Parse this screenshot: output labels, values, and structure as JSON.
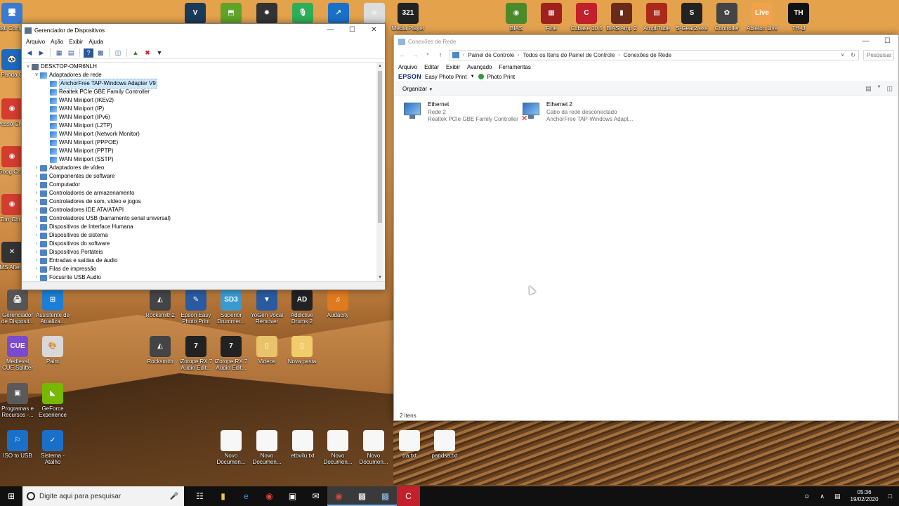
{
  "desktop": {
    "top_icons": [
      {
        "label": "",
        "glyph": "V",
        "color": "#1b3a5a"
      },
      {
        "label": "",
        "glyph": "⬒",
        "color": "#5fa329"
      },
      {
        "label": "",
        "glyph": "✹",
        "color": "#333333"
      },
      {
        "label": "",
        "glyph": "🎙",
        "color": "#2fae5a"
      },
      {
        "label": "",
        "glyph": "↗",
        "color": "#1a70c8"
      },
      {
        "label": "",
        "glyph": "☠",
        "color": "#dddddd"
      },
      {
        "label": "Media Player",
        "glyph": "321",
        "color": "#222222"
      },
      {
        "label": "BIAS",
        "glyph": "◉",
        "color": "#4a8a2a"
      },
      {
        "label": "Fine",
        "glyph": "▦",
        "color": "#a0201e"
      },
      {
        "label": "Cubase 10.5",
        "glyph": "C",
        "color": "#c2202a"
      },
      {
        "label": "BIAS Amp 2",
        "glyph": "▮",
        "color": "#6a2a1a"
      },
      {
        "label": "AmpliTube",
        "glyph": "▤",
        "color": "#aa2a1a"
      },
      {
        "label": "S-Gear2.exe -",
        "glyph": "S",
        "color": "#222222"
      },
      {
        "label": "Controller",
        "glyph": "✿",
        "color": "#444444"
      },
      {
        "label": "Ableton Live",
        "glyph": "Live",
        "color": "#f1a24a"
      },
      {
        "label": "TH-U",
        "glyph": "TH",
        "color": "#111111"
      }
    ],
    "left_icons": [
      {
        "label": "Esti Compu",
        "glyph": "🖥",
        "color": "#3a7ad0"
      },
      {
        "label": "",
        "glyph": "◉",
        "color": "#d33c2e"
      },
      {
        "label": "Panda C",
        "glyph": "🐼",
        "color": "#1c6ac0"
      },
      {
        "label": "Pesso Chro",
        "glyph": "◉",
        "color": "#d33c2e"
      },
      {
        "label": "Goog Chro",
        "glyph": "◉",
        "color": "#d33c2e"
      },
      {
        "label": "Torr Chro",
        "glyph": "◉",
        "color": "#d33c2e"
      },
      {
        "label": "MS Afterb",
        "glyph": "✕",
        "color": "#333333"
      }
    ],
    "grid_icons": [
      {
        "label": "Gerenciador de Disposit...",
        "glyph": "🖨",
        "color": "#555555"
      },
      {
        "label": "Assistente de Atualiza...",
        "glyph": "⊞",
        "color": "#1b7fd6"
      },
      {
        "label": "Rocksmith2",
        "glyph": "◭",
        "color": "#444444"
      },
      {
        "label": "Epson Easy Photo Print",
        "glyph": "✎",
        "color": "#2a5aa0"
      },
      {
        "label": "Superior Drummer...",
        "glyph": "SD3",
        "color": "#3a9ad0"
      },
      {
        "label": "YoGen Vocal Remover",
        "glyph": "▼",
        "color": "#2a5aa0"
      },
      {
        "label": "Addictive Drums 2",
        "glyph": "AD",
        "color": "#222222"
      },
      {
        "label": "Audacity",
        "glyph": "♫",
        "color": "#e07a1e"
      },
      {
        "label": "Medieval CUE Splitter",
        "glyph": "CUE",
        "color": "#7a4ad0"
      },
      {
        "label": "Paint",
        "glyph": "🎨",
        "color": "#d8d8d8"
      },
      {
        "label": "Rocksmith",
        "glyph": "◭",
        "color": "#444444"
      },
      {
        "label": "iZotope RX 7 Audio Edit...",
        "glyph": "7",
        "color": "#222222"
      },
      {
        "label": "iZotope RX 7 Audio Edit...",
        "glyph": "7",
        "color": "#222222"
      },
      {
        "label": "Videos",
        "glyph": "▯",
        "color": "#e9c36a"
      },
      {
        "label": "Nova pasta",
        "glyph": "▯",
        "color": "#f0cc6a"
      },
      {
        "label": "Programas e Recursos -...",
        "glyph": "▣",
        "color": "#5a5a5a"
      },
      {
        "label": "GeForce Experience",
        "glyph": "◣",
        "color": "#76b900"
      },
      {
        "label": "ISO to USB",
        "glyph": "⚐",
        "color": "#1a70c8"
      },
      {
        "label": "Sistema - Atalho",
        "glyph": "✓",
        "color": "#1a70c8"
      }
    ],
    "file_icons": [
      {
        "label": "Novo Documen..."
      },
      {
        "label": "Novo Documen..."
      },
      {
        "label": "etbvilu.txt"
      },
      {
        "label": "Novo Documen..."
      },
      {
        "label": "Novo Documen..."
      },
      {
        "label": "tra.txt"
      },
      {
        "label": "pandsa.txt"
      }
    ]
  },
  "device_manager": {
    "title": "Gerenciador de Dispositivos",
    "menu": [
      "Arquivo",
      "Ação",
      "Exibir",
      "Ajuda"
    ],
    "root": "DESKTOP-OMR6NLH",
    "expanded_category": "Adaptadores de rede",
    "adapters": [
      "AnchorFree TAP-Windows Adapter V9",
      "Realtek PCIe GBE Family Controller",
      "WAN Miniport (IKEv2)",
      "WAN Miniport (IP)",
      "WAN Miniport (IPv6)",
      "WAN Miniport (L2TP)",
      "WAN Miniport (Network Monitor)",
      "WAN Miniport (PPPOE)",
      "WAN Miniport (PPTP)",
      "WAN Miniport (SSTP)"
    ],
    "categories": [
      "Adaptadores de vídeo",
      "Componentes de software",
      "Computador",
      "Controladores de armazenamento",
      "Controladores de som, vídeo e jogos",
      "Controladores IDE ATA/ATAPI",
      "Controladores USB (barramento serial universal)",
      "Dispositivos de Interface Humana",
      "Dispositivos de sistema",
      "Dispositivos do software",
      "Dispositivos Portáteis",
      "Entradas e saídas de áudio",
      "Filas de impressão",
      "Focusrite USB Audio"
    ]
  },
  "network_connections": {
    "title": "Conexões de Rede",
    "breadcrumb": [
      "Painel de Controle",
      "Todos os Itens do Painel de Controle",
      "Conexões de Rede"
    ],
    "search_placeholder": "Pesquisar",
    "menu": [
      "Arquivo",
      "Editar",
      "Exibir",
      "Avançado",
      "Ferramentas"
    ],
    "epson_brand": "EPSON",
    "epson_app": "Easy Photo Print",
    "photo_print": "Photo Print",
    "organize": "Organizar",
    "connections": [
      {
        "name": "Ethernet",
        "status": "Rede 2",
        "adapter": "Realtek PCIe GBE Family Controller"
      },
      {
        "name": "Ethernet 2",
        "status": "Cabo da rede desconectado",
        "adapter": "AnchorFree TAP-Windows Adapt..."
      }
    ],
    "item_count": "2 itens"
  },
  "taskbar": {
    "search_placeholder": "Digite aqui para pesquisar",
    "time": "05:36",
    "date": "19/02/2020"
  }
}
